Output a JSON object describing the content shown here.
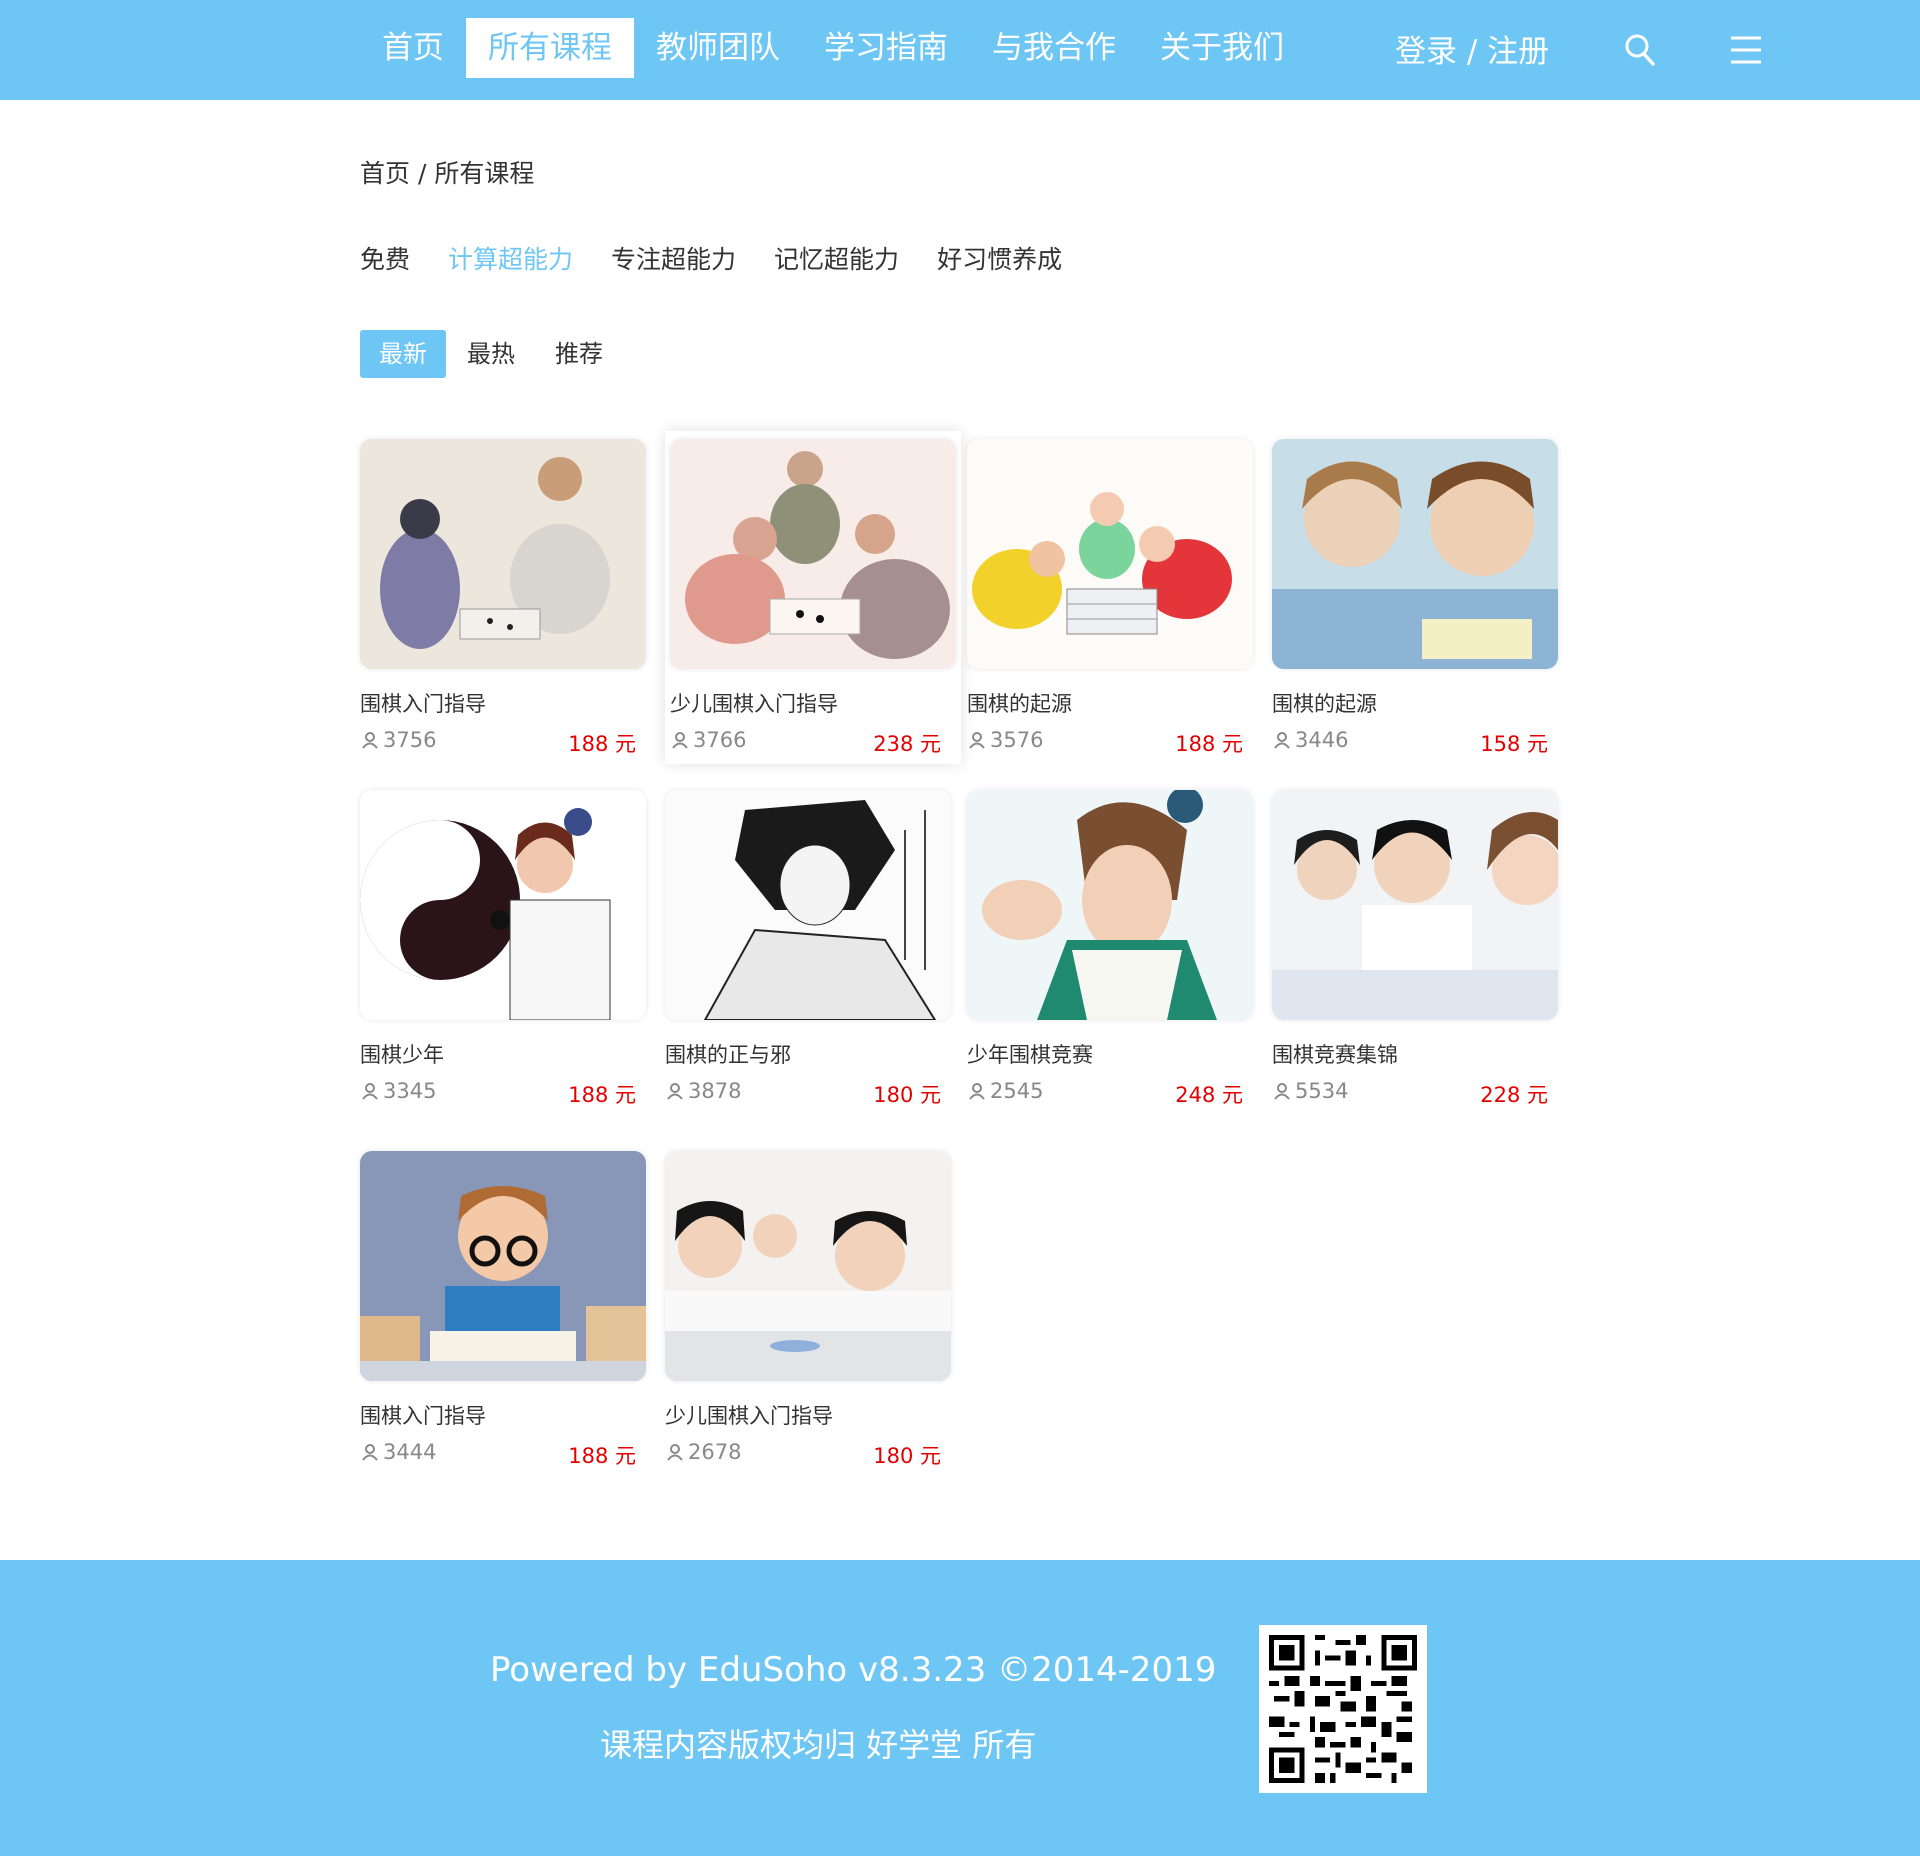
{
  "header": {
    "nav": [
      "首页",
      "所有课程",
      "教师团队",
      "学习指南",
      "与我合作",
      "关于我们"
    ],
    "active_nav": 1,
    "login": "登录 / 注册",
    "search_icon": "search-icon",
    "menu_icon": "menu-icon"
  },
  "breadcrumb": {
    "home": "首页",
    "separator": " / ",
    "current": "所有课程"
  },
  "categories": {
    "items": [
      "免费",
      "计算超能力",
      "专注超能力",
      "记忆超能力",
      "好习惯养成"
    ],
    "active": 1
  },
  "sorts": {
    "items": [
      "最新",
      "最热",
      "推荐"
    ],
    "active": 0
  },
  "courses": [
    {
      "title": "围棋入门指导",
      "students": "3756",
      "price": "188 元"
    },
    {
      "title": "少儿围棋入门指导",
      "students": "3766",
      "price": "238 元"
    },
    {
      "title": "围棋的起源",
      "students": "3576",
      "price": "188 元"
    },
    {
      "title": "围棋的起源",
      "students": "3446",
      "price": "158 元"
    },
    {
      "title": "围棋少年",
      "students": "3345",
      "price": "188 元"
    },
    {
      "title": "围棋的正与邪",
      "students": "3878",
      "price": "180 元"
    },
    {
      "title": "少年围棋竞赛",
      "students": "2545",
      "price": "248 元"
    },
    {
      "title": "围棋竞赛集锦",
      "students": "5534",
      "price": "228 元"
    },
    {
      "title": "围棋入门指导",
      "students": "3444",
      "price": "188 元"
    },
    {
      "title": "少儿围棋入门指导",
      "students": "2678",
      "price": "180 元"
    }
  ],
  "footer": {
    "powered": "Powered by EduSoho v8.3.23 ©2014-2019",
    "copyright": "课程内容版权均归 好学堂 所有"
  },
  "colors": {
    "accent": "#6ec6f4",
    "price": "#e40000"
  }
}
